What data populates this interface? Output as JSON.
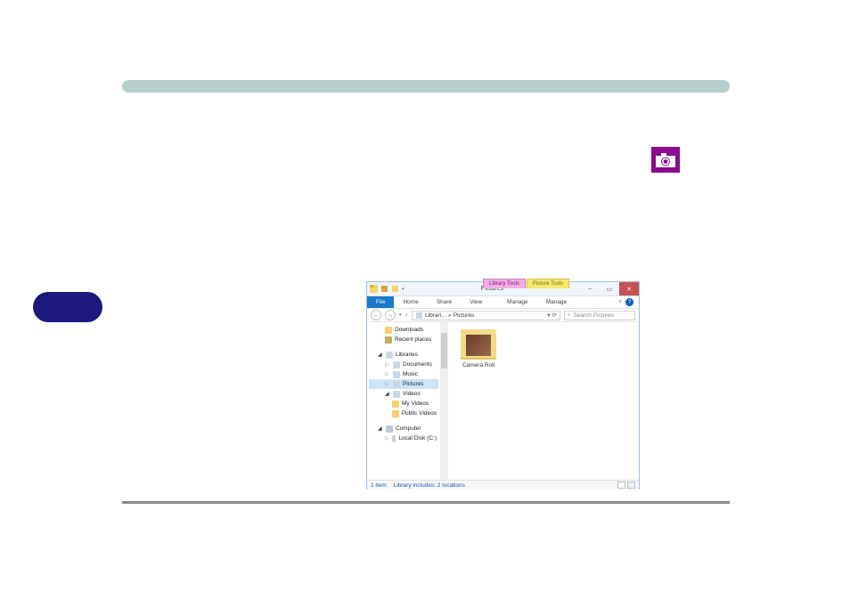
{
  "explorer": {
    "title": "Pictures",
    "toolTabs": {
      "library": "Library Tools",
      "picture": "Picture Tools"
    },
    "windowControls": {
      "min": "–",
      "max": "▭",
      "close": "✕"
    },
    "ribbon": {
      "file": "File",
      "home": "Home",
      "share": "Share",
      "view": "View",
      "manage1": "Manage",
      "manage2": "Manage"
    },
    "nav": {
      "back": "←",
      "forward": "→",
      "up": "↑",
      "refresh": "⟳",
      "down": "▾"
    },
    "address": {
      "root": "Librari…",
      "sep": "▸",
      "current": "Pictures"
    },
    "search": {
      "icon": "🔍",
      "placeholder": "Search Pictures"
    },
    "tree": {
      "downloads": "Downloads",
      "recent": "Recent places",
      "libraries": "Libraries",
      "documents": "Documents",
      "music": "Music",
      "pictures": "Pictures",
      "videos": "Videos",
      "myvideos": "My Videos",
      "publicvideos": "Public Videos",
      "computer": "Computer",
      "disk": "Local Disk (C:)"
    },
    "items": {
      "cameraRoll": "Camera Roll"
    },
    "status": {
      "count": "1 item",
      "locations": "Library includes: 2 locations"
    }
  }
}
